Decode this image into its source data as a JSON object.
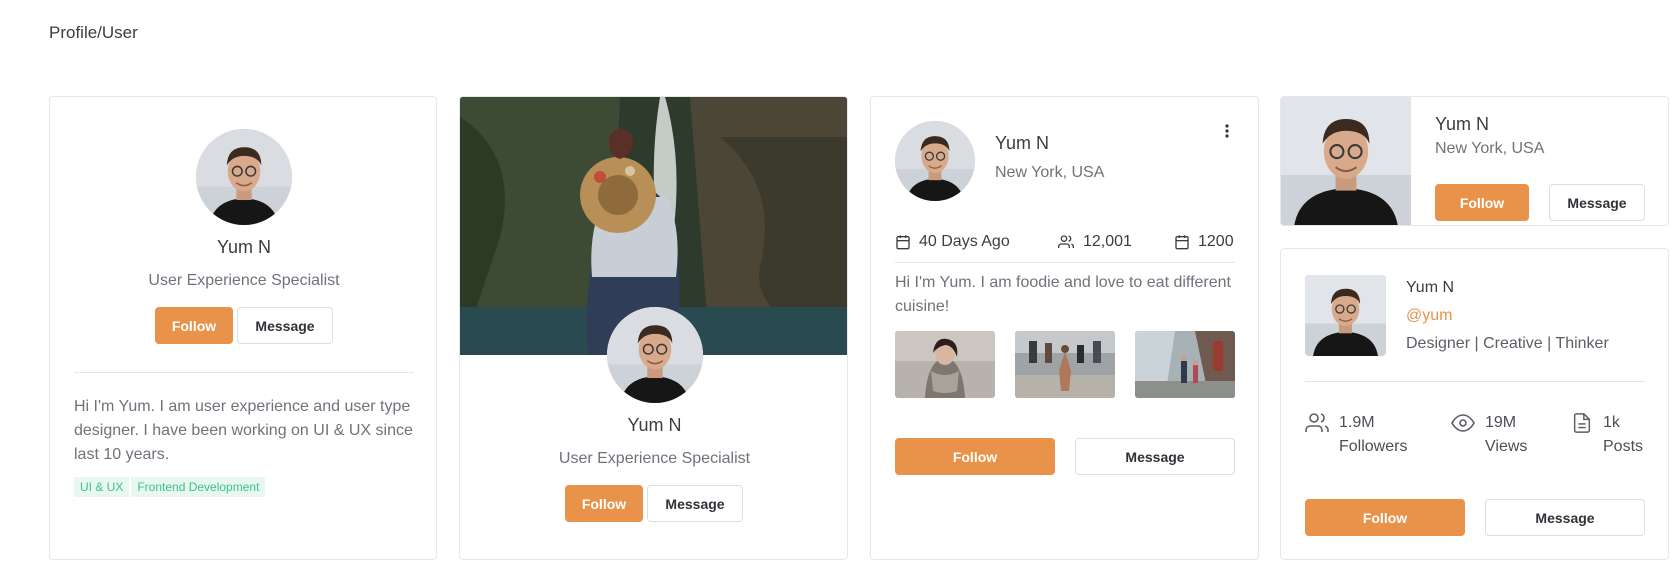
{
  "page": {
    "title": "Profile/User"
  },
  "card1": {
    "name": "Yum N",
    "role": "User Experience Specialist",
    "follow_label": "Follow",
    "message_label": "Message",
    "bio": "Hi I'm Yum. I am user experience and user type designer. I have been working on UI & UX since last 10 years.",
    "tags": [
      "UI & UX",
      "Frontend Development"
    ]
  },
  "card2": {
    "name": "Yum N",
    "role": "User Experience Specialist",
    "follow_label": "Follow",
    "message_label": "Message"
  },
  "card3": {
    "name": "Yum N",
    "location": "New York, USA",
    "meta": {
      "date": "40 Days Ago",
      "followers": "12,001",
      "count": "1200"
    },
    "bio": "Hi I'm Yum. I am foodie and love to eat different cuisine!",
    "follow_label": "Follow",
    "message_label": "Message"
  },
  "card4": {
    "name": "Yum N",
    "location": "New York, USA",
    "follow_label": "Follow",
    "message_label": "Message"
  },
  "card5": {
    "name": "Yum N",
    "handle": "@yum",
    "tagline": "Designer | Creative | Thinker",
    "stats": {
      "followers_value": "1.9M",
      "followers_label": "Followers",
      "views_value": "19M",
      "views_label": "Views",
      "posts_value": "1k",
      "posts_label": "Posts"
    },
    "follow_label": "Follow",
    "message_label": "Message"
  },
  "colors": {
    "accent": "#e8924a",
    "tag_text": "#3ec28a",
    "tag_bg": "#e8f8f0",
    "handle": "#e8924a"
  },
  "icons": [
    "more-vertical-icon",
    "calendar-icon",
    "users-icon",
    "eye-icon",
    "document-icon"
  ]
}
